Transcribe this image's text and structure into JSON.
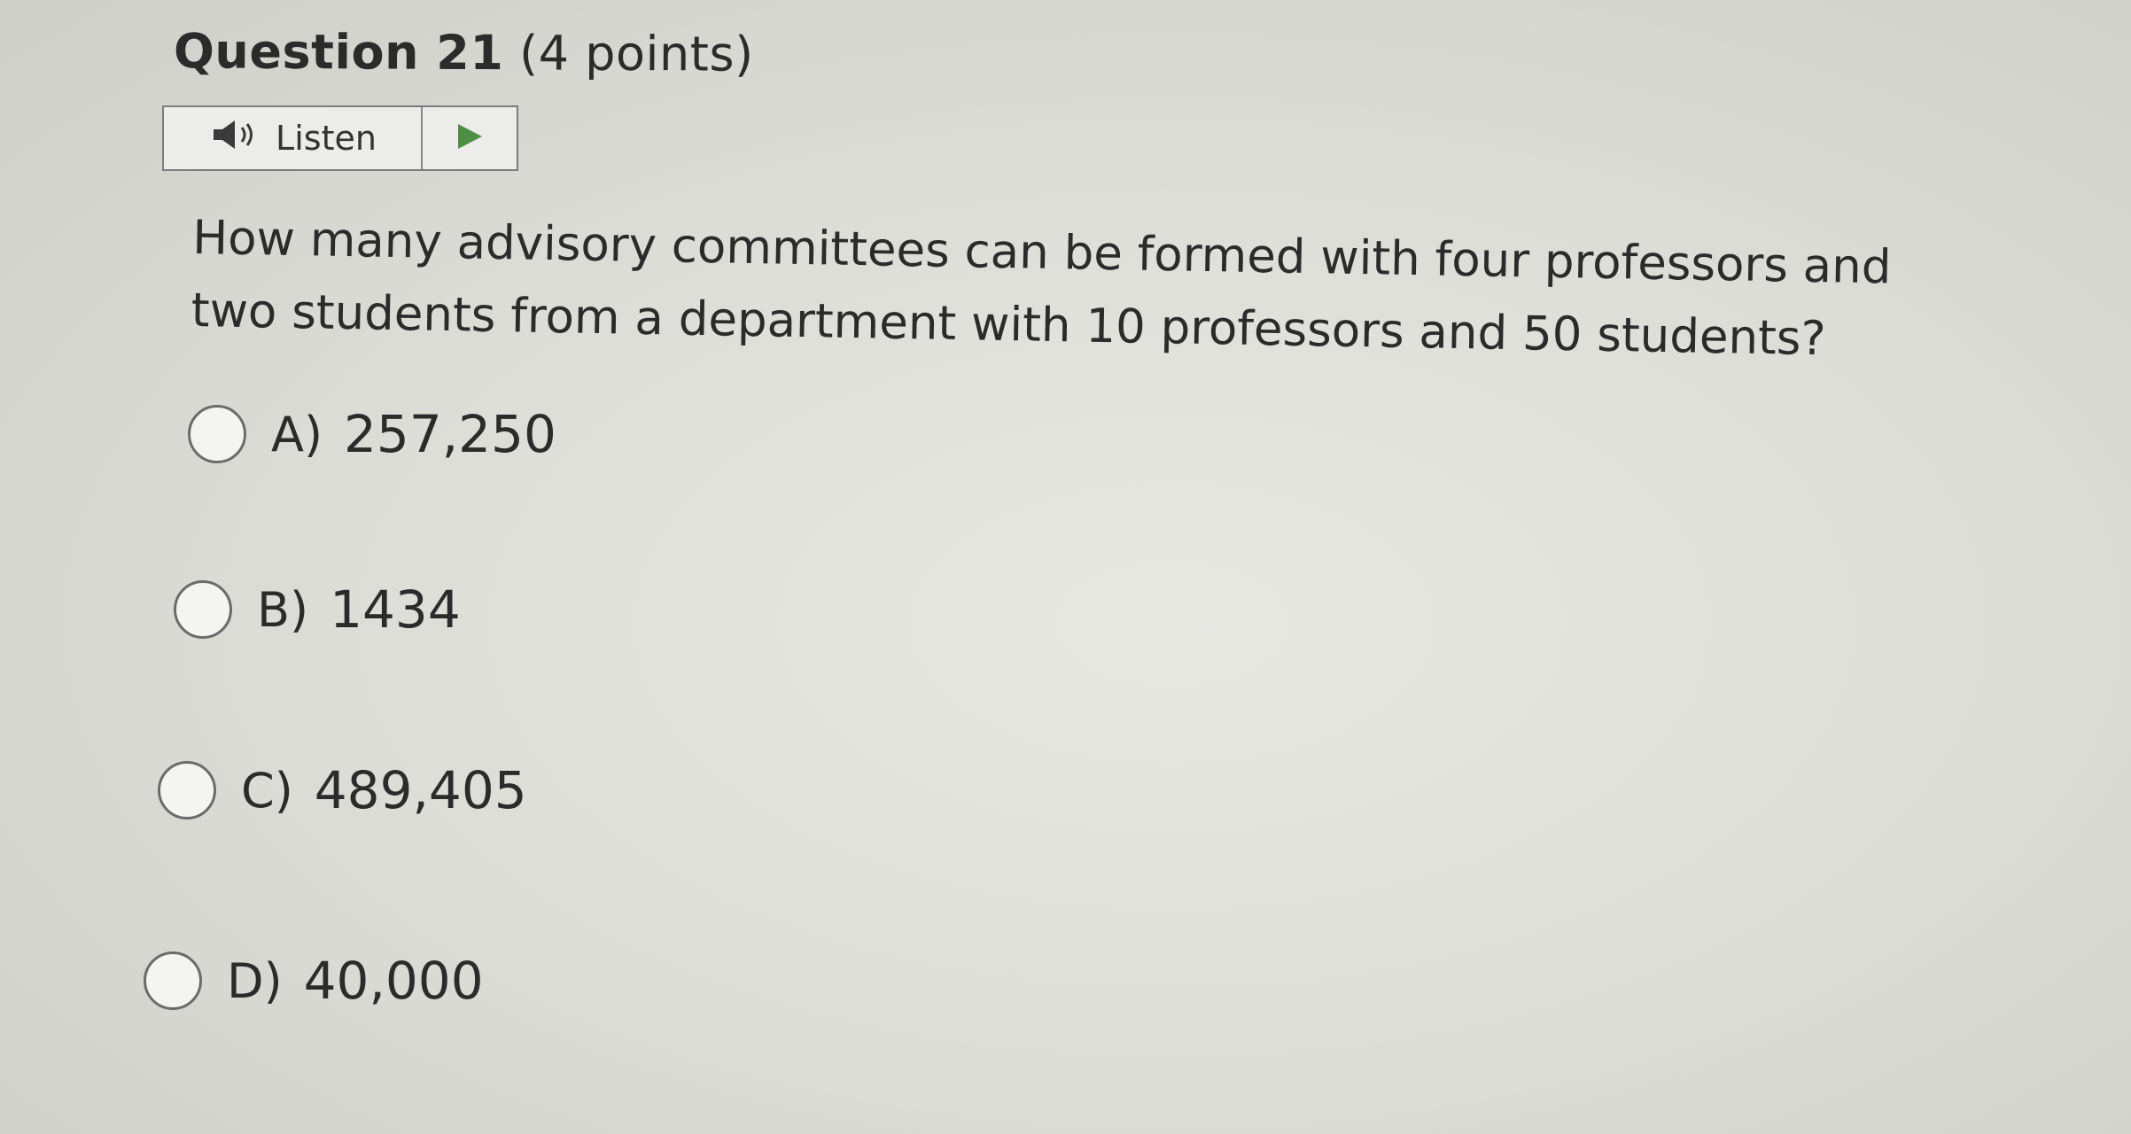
{
  "question": {
    "title": "Question 21",
    "points": "(4 points)",
    "text": "How many advisory committees can be formed with four professors and two students from a department with 10 professors and 50 students?"
  },
  "listen": {
    "label": "Listen",
    "speaker_icon": "speaker-icon",
    "play_icon": "play-icon",
    "play_color": "#4f8f45"
  },
  "options": [
    {
      "letter": "A)",
      "value": "257,250"
    },
    {
      "letter": "B)",
      "value": "1434"
    },
    {
      "letter": "C)",
      "value": "489,405"
    },
    {
      "letter": "D)",
      "value": "40,000"
    }
  ]
}
